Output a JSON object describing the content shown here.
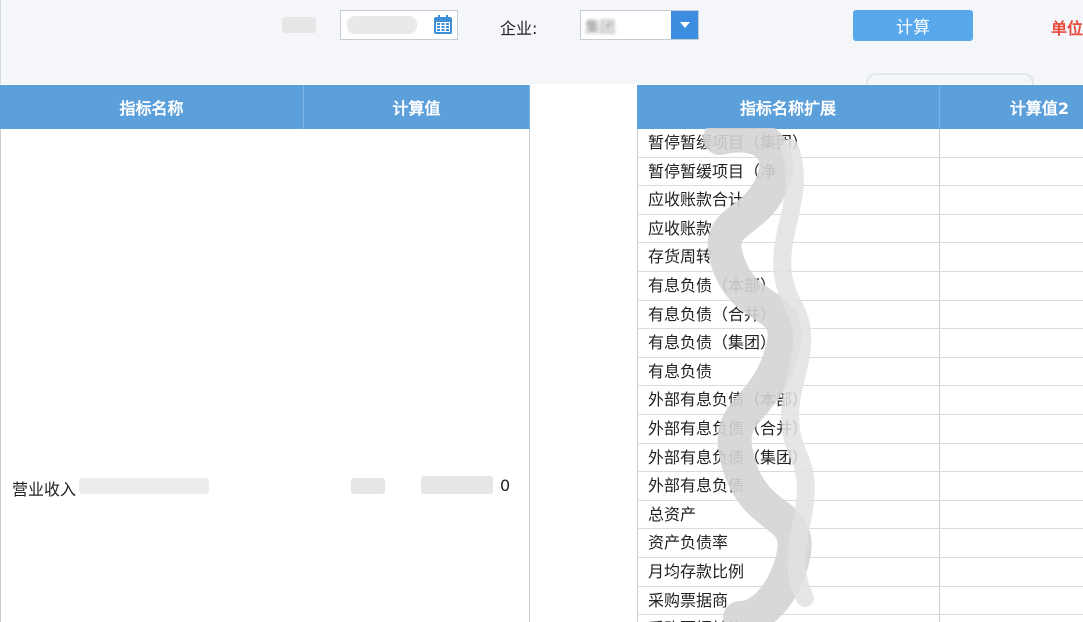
{
  "toolbar": {
    "date_icon": "calendar-icon",
    "company_label": "企业:",
    "company_value": "集团",
    "dropdown_icon": "chevron-down-icon",
    "calc_button": "计算",
    "unit_label": "单位"
  },
  "left_table": {
    "headers": [
      "指标名称",
      "计算值"
    ],
    "row": {
      "name": "营业收入",
      "value": "0"
    }
  },
  "right_table": {
    "headers": [
      "指标名称扩展",
      "计算值2"
    ],
    "rows": [
      "暂停暂缓项目（集团）",
      "暂停暂缓项目（净",
      "应收账款合计",
      "应收账款",
      "存货周转",
      "有息负债（本部）",
      "有息负债（合并）",
      "有息负债（集团）",
      "有息负债",
      "外部有息负债（本部）",
      "外部有息负债（合并）",
      "外部有息负债（集团）",
      "外部有息负债",
      "总资产",
      "资产负债率",
      "月均存款比例",
      "采购票据商",
      "采购票据转换"
    ]
  },
  "colors": {
    "header": "#5b9fdb",
    "button": "#58a8ec",
    "unit": "#e84b3c"
  }
}
